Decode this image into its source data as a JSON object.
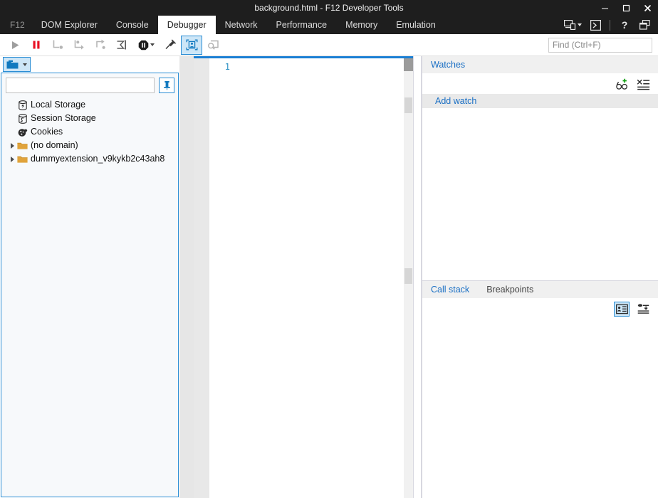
{
  "window": {
    "title": "background.html - F12 Developer Tools",
    "buttons": {
      "minimize": "–",
      "maximize": "❐",
      "close": "✕"
    }
  },
  "tabstrip": {
    "f12_label": "F12",
    "tabs": [
      {
        "label": "DOM Explorer",
        "active": false
      },
      {
        "label": "Console",
        "active": false
      },
      {
        "label": "Debugger",
        "active": true
      },
      {
        "label": "Network",
        "active": false
      },
      {
        "label": "Performance",
        "active": false
      },
      {
        "label": "Memory",
        "active": false
      },
      {
        "label": "Emulation",
        "active": false
      }
    ],
    "right_icons": [
      {
        "name": "device-emulation-icon"
      },
      {
        "name": "console-drawer-icon"
      },
      {
        "name": "help-icon",
        "glyph": "?"
      },
      {
        "name": "undock-window-icon"
      }
    ]
  },
  "toolbar": {
    "buttons": [
      {
        "name": "continue-button",
        "tooltip": "Continue"
      },
      {
        "name": "break-all-button",
        "tooltip": "Break all"
      },
      {
        "name": "step-into-button",
        "tooltip": "Step into"
      },
      {
        "name": "step-over-button",
        "tooltip": "Step over"
      },
      {
        "name": "step-out-button",
        "tooltip": "Step out"
      },
      {
        "name": "break-on-new-worker-button",
        "tooltip": "Break on new worker"
      },
      {
        "name": "break-conditions-button",
        "tooltip": "Change exception behavior"
      },
      {
        "name": "toggle-breakpoints-button",
        "tooltip": "Toggle breakpoints"
      },
      {
        "name": "pretty-print-button",
        "tooltip": "Pretty print",
        "selected": true
      },
      {
        "name": "word-wrap-button",
        "tooltip": "Word wrap"
      }
    ],
    "find": {
      "placeholder": "Find (Ctrl+F)",
      "value": ""
    }
  },
  "left_panel": {
    "scope_button": {
      "name": "storage-scope-button"
    },
    "search": {
      "placeholder": "",
      "value": ""
    },
    "pin_button": {
      "name": "pin-button"
    },
    "tree": [
      {
        "label": "Local Storage",
        "icon": "local-storage-icon",
        "expandable": false
      },
      {
        "label": "Session Storage",
        "icon": "session-storage-icon",
        "expandable": false
      },
      {
        "label": "Cookies",
        "icon": "cookies-icon",
        "expandable": false
      },
      {
        "label": "(no domain)",
        "icon": "folder-icon",
        "expandable": true
      },
      {
        "label": "dummyextension_v9kykb2c43ah8",
        "icon": "folder-icon",
        "expandable": true
      }
    ]
  },
  "editor": {
    "line_numbers": [
      "1"
    ],
    "lines": [
      ""
    ],
    "accent_color": "#1a7fd4"
  },
  "right_panel": {
    "watches": {
      "tab_label": "Watches",
      "tools": [
        {
          "name": "add-watch-icon"
        },
        {
          "name": "delete-all-watches-icon"
        }
      ],
      "add_watch_label": "Add watch",
      "rows": []
    },
    "callstack": {
      "tabs": [
        {
          "label": "Call stack",
          "active": true
        },
        {
          "label": "Breakpoints",
          "active": false
        }
      ],
      "tools": [
        {
          "name": "show-external-code-icon",
          "selected": true
        },
        {
          "name": "collapse-frames-icon",
          "selected": false
        }
      ],
      "rows": []
    }
  }
}
